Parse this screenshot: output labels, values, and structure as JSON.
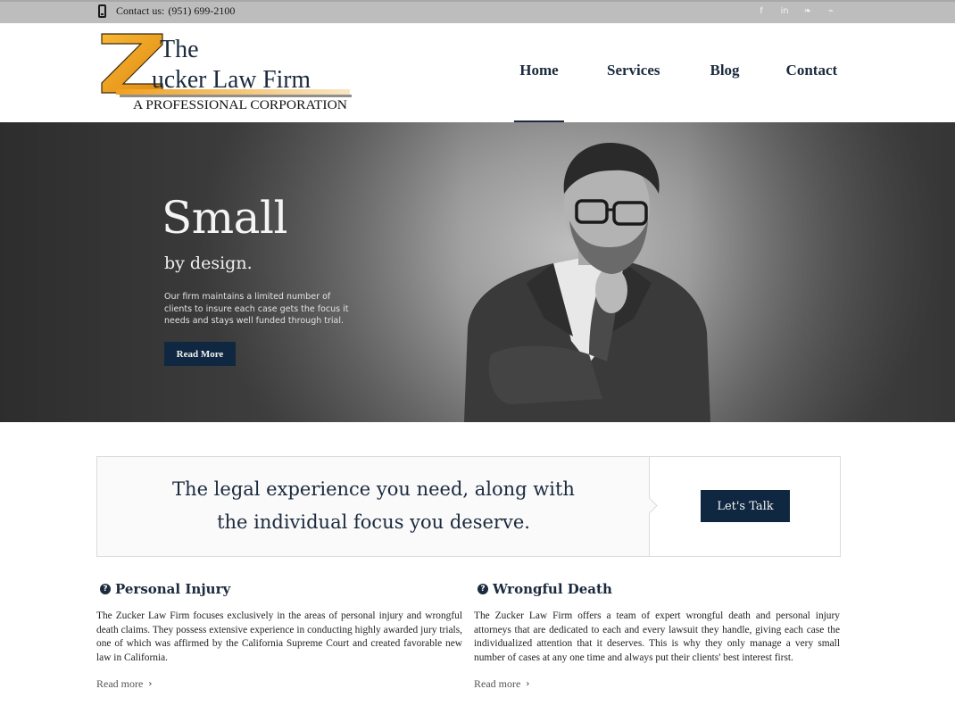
{
  "topbar": {
    "contact_label": "Contact us:",
    "phone": "(951) 699-2100",
    "socials": [
      {
        "icon": "facebook-icon",
        "glyph": "f"
      },
      {
        "icon": "linkedin-icon",
        "glyph": "in"
      },
      {
        "icon": "twitter-icon",
        "glyph": "❧"
      },
      {
        "icon": "rss-icon",
        "glyph": "⌁"
      }
    ]
  },
  "logo": {
    "letter": "Z",
    "the": "The",
    "name": "ucker Law Firm",
    "tagline": "A PROFESSIONAL CORPORATION",
    "accent_color": "#f0a020"
  },
  "nav": {
    "items": [
      {
        "label": "Home",
        "active": true
      },
      {
        "label": "Services",
        "active": false
      },
      {
        "label": "Blog",
        "active": false
      },
      {
        "label": "Contact",
        "active": false
      }
    ]
  },
  "hero": {
    "title": "Small",
    "subtitle": "by design.",
    "text": "Our firm maintains a limited number of clients to insure each case gets the focus it needs and stays well funded through trial.",
    "button": "Read More"
  },
  "cta": {
    "line1": "The legal experience you need, along with",
    "line2": "the individual focus you deserve.",
    "button": "Let's Talk"
  },
  "services": [
    {
      "title": "Personal Injury",
      "text": "The Zucker Law Firm focuses exclusively in the areas of personal injury and wrongful death claims. They possess extensive experience in conducting highly awarded jury trials, one of which was affirmed by the California Supreme Court and created favorable new law in California.",
      "more": "Read more"
    },
    {
      "title": "Wrongful Death",
      "text": "The Zucker Law Firm offers a team of expert wrongful death and personal injury attorneys that are dedicated to each and every lawsuit they handle, giving each case the individualized attention that it deserves. This is why they only manage a very small number of cases at any one time and always put their clients' best interest first.",
      "more": "Read more"
    }
  ],
  "colors": {
    "navy": "#0f2740",
    "text": "#1b2a3e",
    "topbar": "#bdbdbd"
  }
}
